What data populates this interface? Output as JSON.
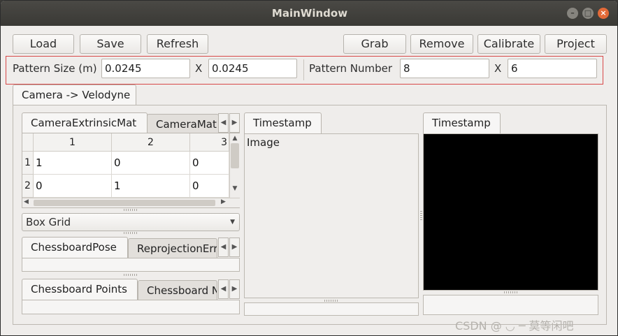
{
  "window": {
    "title": "MainWindow"
  },
  "toolbar": {
    "load": "Load",
    "save": "Save",
    "refresh": "Refresh",
    "grab": "Grab",
    "remove": "Remove",
    "calibrate": "Calibrate",
    "project": "Project"
  },
  "params": {
    "pattern_size_label": "Pattern Size (m)",
    "pattern_size_x": "0.0245",
    "times_1": "X",
    "pattern_size_y": "0.0245",
    "pattern_number_label": "Pattern Number",
    "pattern_number_x": "8",
    "times_2": "X",
    "pattern_number_y": "6"
  },
  "main_tab": "Camera -> Velodyne",
  "matrix_tabs": [
    "CameraExtrinsicMat",
    "CameraMat"
  ],
  "matrix_table": {
    "columns": [
      "1",
      "2",
      "3"
    ],
    "rows": [
      {
        "header": "1",
        "cells": [
          "1",
          "0",
          "0"
        ]
      },
      {
        "header": "2",
        "cells": [
          "0",
          "1",
          "0"
        ]
      }
    ]
  },
  "dropdown": {
    "selected": "Box Grid"
  },
  "pose_tabs": [
    "ChessboardPose",
    "ReprojectionError"
  ],
  "points_tabs": [
    "Chessboard Points",
    "Chessboard N"
  ],
  "image_panel": {
    "tab": "Timestamp",
    "content_label": "Image"
  },
  "right_panel": {
    "tab": "Timestamp"
  },
  "watermark": "CSDN @ ◡ ─ 莫等闲吧"
}
